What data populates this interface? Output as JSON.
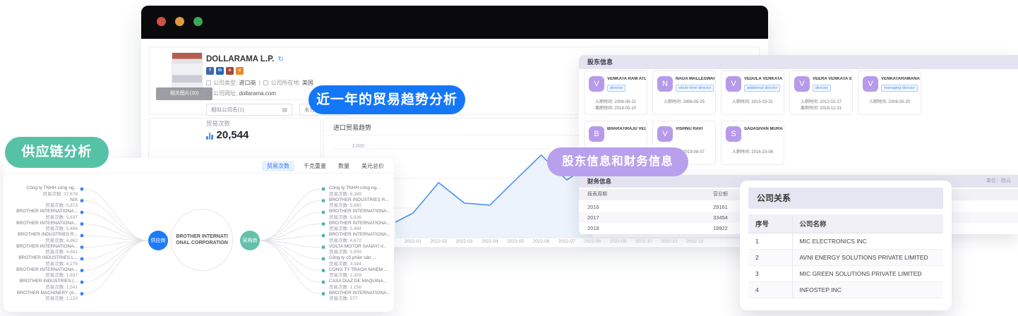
{
  "badges": {
    "supply_chain": "供应链分析",
    "trade_trend": "近一年的贸易趋势分析",
    "shareholder_finance": "股东信息和财务信息"
  },
  "browser": {
    "company": {
      "name": "DOLLARAMA L.P.",
      "image_caption": "相关图片(20)",
      "type_label": "公司类型:",
      "type_value": "进口商",
      "separator": "|",
      "location_label": "公司所在地:",
      "location_value": "美国",
      "website_label": "公司网址:",
      "website_value": "dollarama.com",
      "similar_company_dropdown": "相似公司名(1)",
      "group_dropdown": "未分组",
      "social_icons": [
        {
          "name": "facebook",
          "color": "#4267b2",
          "glyph": "f"
        },
        {
          "name": "linkedin",
          "color": "#2867b2",
          "glyph": "in"
        },
        {
          "name": "instagram",
          "color": "#a5473f",
          "glyph": "o"
        },
        {
          "name": "phone",
          "color": "#e8882f",
          "glyph": "c"
        }
      ]
    },
    "stats": {
      "trade_count_label": "贸易次数",
      "trade_count_value": "20,544"
    }
  },
  "chart_data": {
    "type": "line",
    "title": "进口贸易趋势",
    "x": [
      "2022-01",
      "2022-02",
      "2022-03",
      "2022-04",
      "2022-05",
      "2022-06",
      "2022-07",
      "2022-08",
      "2022-09",
      "2022-10",
      "2022-11",
      "2022-12"
    ],
    "values": [
      830,
      1860,
      1170,
      1100,
      1950,
      2790,
      1950,
      2500,
      null,
      null,
      null,
      null
    ],
    "ylim": [
      0,
      3000
    ],
    "y_tick_label": "3,000",
    "grid": true,
    "legend": "none",
    "line_color": "#4a90f4",
    "area_color": "#e9f1fc",
    "note": "right portion (2022-08 onward) hidden behind overlapping panels"
  },
  "supply_panel": {
    "tabs": [
      {
        "label": "贸易次数",
        "active": true
      },
      {
        "label": "千克重量",
        "active": false
      },
      {
        "label": "数量",
        "active": false
      },
      {
        "label": "美元总价",
        "active": false
      }
    ],
    "center_company": "BROTHER INTERNATIONAL CORPORATION",
    "supplier_node": "供应商",
    "buyer_node": "采购商",
    "metric_label": "贸易次数:",
    "suppliers": [
      {
        "name": "Công ty TNHH công ng...",
        "value": "37,678"
      },
      {
        "name": "N/A",
        "value": "5,873"
      },
      {
        "name": "BROTHER INTERNATIONA...",
        "value": "5,837"
      },
      {
        "name": "BROTHER INTERNATIONA...",
        "value": "5,466"
      },
      {
        "name": "BROTHER INDUSTRIES R...",
        "value": "4,962"
      },
      {
        "name": "BROTHER INTERNATIONA...",
        "value": "4,681"
      },
      {
        "name": "BROTHER INDUSTRIES L...",
        "value": "4,275"
      },
      {
        "name": "BROTHER INTERNATIONA...",
        "value": "1,937"
      },
      {
        "name": "BROTHER INDUSTRIES (...",
        "value": "1,541"
      },
      {
        "name": "BROTHER MACHINERY (A...",
        "value": "1,120"
      }
    ],
    "buyers": [
      {
        "name": "Công ty TNHH công ng...",
        "value": "8,389"
      },
      {
        "name": "BROTHER INDUSTRIES R...",
        "value": "5,860"
      },
      {
        "name": "BROTHER INTERNATIONA...",
        "value": "5,836"
      },
      {
        "name": "BROTHER INTERNATIONA...",
        "value": "5,484"
      },
      {
        "name": "BROTHER INTERNATIONA...",
        "value": "4,672"
      },
      {
        "name": "VOLTA MOTOR SANAYİ V...",
        "value": "3,959"
      },
      {
        "name": "Công ty cổ phần sản ...",
        "value": "3,394"
      },
      {
        "name": "CÔNG TY TRÁCH NHIỆM ...",
        "value": "2,359"
      },
      {
        "name": "CASA DIAZ DE MAQUINA...",
        "value": "1,158"
      },
      {
        "name": "BROTHER INTERNATIONA...",
        "value": "577"
      }
    ]
  },
  "shareholders": {
    "title": "股东信息",
    "join_label": "入职时间:",
    "leave_label": "离职时间:",
    "cards": [
      {
        "initial": "V",
        "name": "VENKATA RAM ATLURI",
        "role": "director",
        "join": "2006-08-22",
        "leave": "2018-05-10"
      },
      {
        "initial": "N",
        "name": "NAGA MALLESWARA R...",
        "role": "whole-time director",
        "join": "1996-05-25"
      },
      {
        "initial": "V",
        "name": "VEDULA VENKATA RAM...",
        "role": "additional director",
        "join": "2015-03-31"
      },
      {
        "initial": "V",
        "name": "VEERA VENKATA SATYA...",
        "role": "director",
        "join": "2012-02-27",
        "leave": "2018-12-31"
      },
      {
        "initial": "V",
        "name": "VENKATARAMANA MAG...",
        "role": "managing director",
        "join": "2008-05-20"
      },
      {
        "initial": "B",
        "name": "BHARATIRAJU VEGIRAJU"
      },
      {
        "initial": "V",
        "name": "VISHNU RAVI",
        "join": "2019-08-07"
      },
      {
        "initial": "S",
        "name": "SADASIVAN MURALIKR...",
        "join": "2016-10-06"
      }
    ]
  },
  "financial": {
    "title": "财务信息",
    "unit": "单位：欧元",
    "headers": [
      "报表周期",
      "营业额"
    ],
    "rows": [
      [
        "2016",
        "29161"
      ],
      [
        "2017",
        "33454"
      ],
      [
        "2018",
        "19922"
      ]
    ]
  },
  "relations": {
    "title": "公司关系",
    "headers": [
      "序号",
      "公司名称"
    ],
    "rows": [
      [
        "1",
        "MIC ELECTRONICS INC"
      ],
      [
        "2",
        "AVNI ENERGY SOLUTIONS PRIVATE LIMITED"
      ],
      [
        "3",
        "MIC GREEN SOLUTIONS PRIVATE LIMITED"
      ],
      [
        "4",
        "INFOSTEP INC"
      ]
    ]
  },
  "colors": {
    "accent_blue": "#1a7af8",
    "badge_purple": "#b8a0ed",
    "badge_teal": "#55c2a6",
    "avatar_purple": "#b79bea",
    "chart_line": "#4a90f4",
    "supplier_node": "#1f7cf9",
    "buyer_node": "#63c1ab"
  }
}
